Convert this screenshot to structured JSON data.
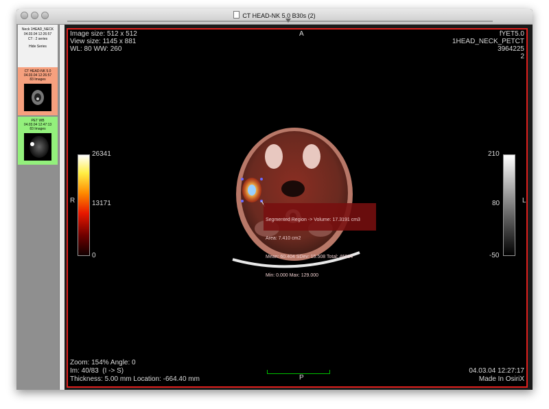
{
  "window": {
    "title": "CT HEAD-NK 5.0 B30s (2)"
  },
  "study": {
    "name": "Neck 1HEAD_NECK",
    "datetime": "04.03.04 12:26:57",
    "series_count": "CT : 2 series",
    "hide_label": "Hide Series"
  },
  "series": [
    {
      "name": "CT HEAD-NK 5.0",
      "datetime": "04.03.04 12:26:57",
      "images": "83 Images",
      "color": "#f6a07e"
    },
    {
      "name": "PET WB",
      "datetime": "04.03.04 12:47:13",
      "images": "83 Images",
      "color": "#93f07c"
    }
  ],
  "overlay": {
    "image_size": "Image size: 512 x 512",
    "view_size": "View size: 1145 x 881",
    "wl_ww": "WL: 80 WW: 260",
    "orient_top": "A",
    "orient_left": "R",
    "orient_right": "L",
    "orient_bottom": "P",
    "patient_id": "fYET5.0",
    "study_name": "1HEAD_NECK_PETCT",
    "accession": "3964225",
    "series_no": "2",
    "zoom_angle": "Zoom: 154% Angle: 0",
    "image_index": "Im: 40/83  (I -> S)",
    "thickness_location": "Thickness: 5.00 mm Location: -664.40 mm",
    "date_time": "04.03.04 12:27:17",
    "made_in": "Made In OsiriX"
  },
  "colorbar_left": {
    "max": "26341",
    "mid": "13171",
    "min": "0"
  },
  "colorbar_right": {
    "max": "210",
    "mid": "80",
    "min": "-50"
  },
  "roi": {
    "line1": "Segmented Region -> Volume: 17.3191 cm3",
    "line2": "Area: 7.410 cm2",
    "line3": "Mean: 60.404 SDev: 15.508 Total: 46934",
    "line4": "Min: 0.000 Max: 129.000"
  },
  "colors": {
    "viewer_border": "#e0201e",
    "roi_handle": "#6a6aff"
  }
}
